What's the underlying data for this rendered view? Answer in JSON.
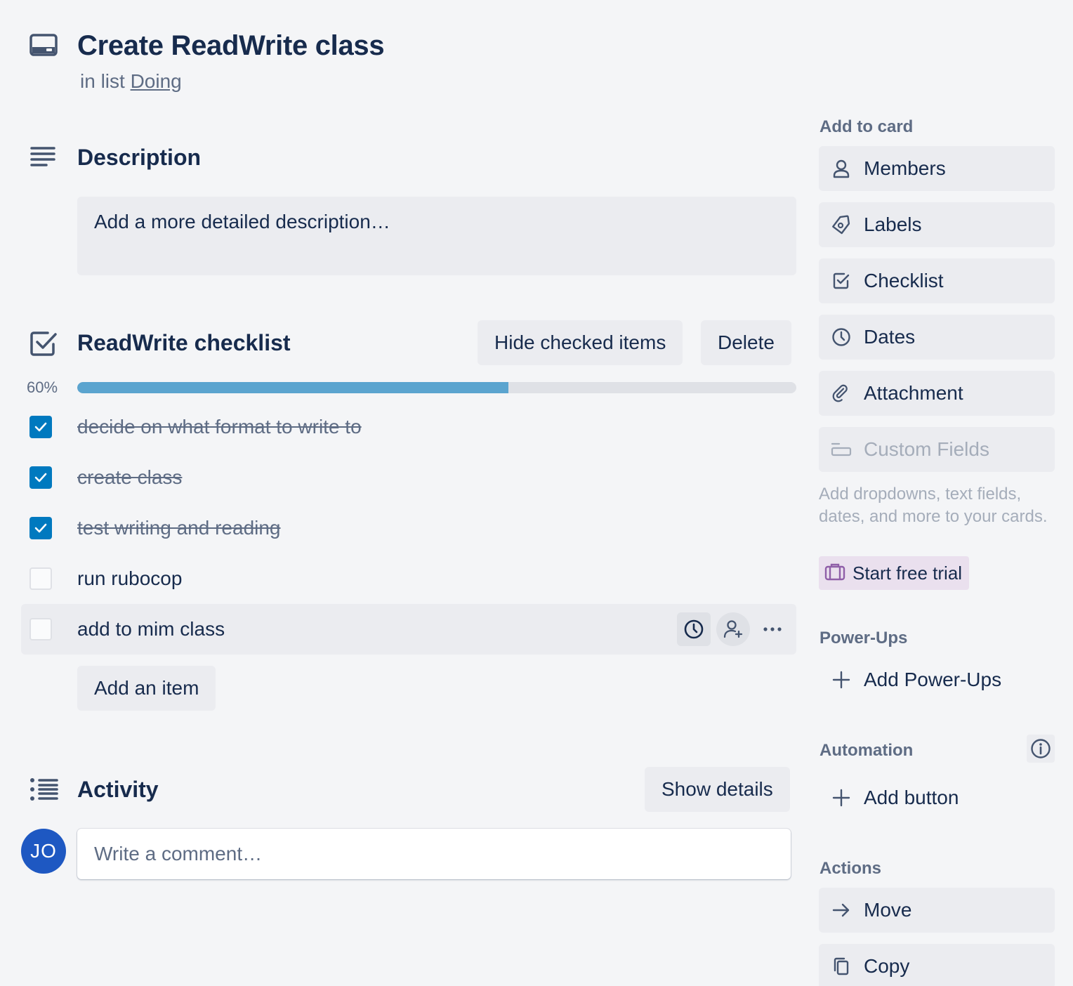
{
  "card": {
    "title": "Create ReadWrite class",
    "in_list_prefix": "in list",
    "list_name": "Doing"
  },
  "description": {
    "heading": "Description",
    "placeholder": "Add a more detailed description…"
  },
  "checklist": {
    "title": "ReadWrite checklist",
    "hide_checked_label": "Hide checked items",
    "delete_label": "Delete",
    "progress_label": "60%",
    "progress_fraction": 0.6,
    "items": [
      {
        "text": "decide on what format to write to",
        "checked": true
      },
      {
        "text": "create class",
        "checked": true
      },
      {
        "text": "test writing and reading",
        "checked": true
      },
      {
        "text": "run rubocop",
        "checked": false
      },
      {
        "text": "add to mim class",
        "checked": false
      }
    ],
    "add_item_label": "Add an item"
  },
  "activity": {
    "heading": "Activity",
    "show_details_label": "Show details",
    "avatar_initials": "JO",
    "comment_placeholder": "Write a comment…"
  },
  "sidebar": {
    "add_to_card_heading": "Add to card",
    "add_to_card": [
      {
        "label": "Members",
        "icon": "person-icon"
      },
      {
        "label": "Labels",
        "icon": "tag-icon"
      },
      {
        "label": "Checklist",
        "icon": "checkbox-icon"
      },
      {
        "label": "Dates",
        "icon": "clock-icon"
      },
      {
        "label": "Attachment",
        "icon": "paperclip-icon"
      },
      {
        "label": "Custom Fields",
        "icon": "custom-fields-icon",
        "disabled": true
      }
    ],
    "custom_fields_hint": "Add dropdowns, text fields, dates, and more to your cards.",
    "start_trial_label": "Start free trial",
    "powerups_heading": "Power-Ups",
    "add_powerups_label": "Add Power-Ups",
    "automation_heading": "Automation",
    "add_button_label": "Add button",
    "actions_heading": "Actions",
    "actions": [
      {
        "label": "Move",
        "icon": "arrow-right-icon"
      },
      {
        "label": "Copy",
        "icon": "copy-icon"
      }
    ]
  },
  "colors": {
    "accent": "#0079bf",
    "progress": "#5ba4cf",
    "avatar": "#1e58c2",
    "trial_bg": "#eae0ee"
  }
}
